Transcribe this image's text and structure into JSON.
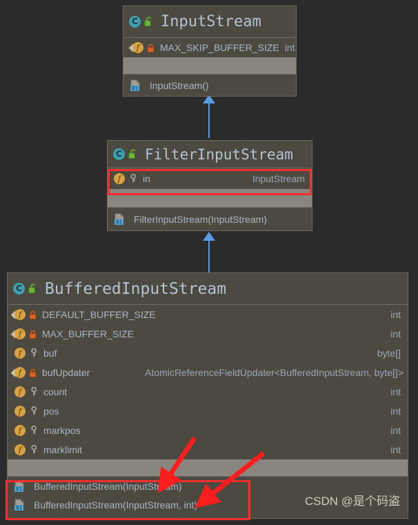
{
  "canvas": {
    "background": "#2b2b2b",
    "box_fill": "#4c4940",
    "box_border": "#6e6b62",
    "divider_band": "#88867f",
    "text_primary": "#a9b7c6",
    "title_color": "#b4c3d4",
    "connector_color": "#5a9ae0",
    "highlight_color": "#f5302c"
  },
  "classes": [
    {
      "id": "input-stream",
      "title": "InputStream",
      "class_icon": "class-icon",
      "visibility_icon": "unlock-icon",
      "fields": [
        {
          "name": "MAX_SKIP_BUFFER_SIZE",
          "type": "int",
          "kind_icon": "static-field-icon",
          "access_icon": "lock-icon",
          "layout": "inline"
        }
      ],
      "methods": [
        {
          "name": "InputStream()",
          "kind_icon": "constructor-icon"
        }
      ]
    },
    {
      "id": "filter-input-stream",
      "title": "FilterInputStream",
      "class_icon": "class-icon",
      "visibility_icon": "unlock-icon",
      "fields": [
        {
          "name": "in",
          "type": "InputStream",
          "kind_icon": "field-icon",
          "access_icon": "key-icon",
          "layout": "spread",
          "highlighted": true
        }
      ],
      "methods": [
        {
          "name": "FilterInputStream(InputStream)",
          "kind_icon": "constructor-icon"
        }
      ]
    },
    {
      "id": "buffered-input-stream",
      "title": "BufferedInputStream",
      "class_icon": "class-icon",
      "visibility_icon": "unlock-icon",
      "fields": [
        {
          "name": "DEFAULT_BUFFER_SIZE",
          "type": "int",
          "kind_icon": "static-field-icon",
          "access_icon": "lock-icon",
          "layout": "spread"
        },
        {
          "name": "MAX_BUFFER_SIZE",
          "type": "int",
          "kind_icon": "static-field-icon",
          "access_icon": "lock-icon",
          "layout": "spread"
        },
        {
          "name": "buf",
          "type": "byte[]",
          "kind_icon": "field-icon",
          "access_icon": "key-icon",
          "layout": "spread"
        },
        {
          "name": "bufUpdater",
          "type": "AtomicReferenceFieldUpdater<BufferedInputStream, byte[]>",
          "kind_icon": "static-field-icon",
          "access_icon": "lock-icon",
          "layout": "spread"
        },
        {
          "name": "count",
          "type": "int",
          "kind_icon": "field-icon",
          "access_icon": "key-icon",
          "layout": "spread"
        },
        {
          "name": "pos",
          "type": "int",
          "kind_icon": "field-icon",
          "access_icon": "key-icon",
          "layout": "spread"
        },
        {
          "name": "markpos",
          "type": "int",
          "kind_icon": "field-icon",
          "access_icon": "key-icon",
          "layout": "spread"
        },
        {
          "name": "marklimit",
          "type": "int",
          "kind_icon": "field-icon",
          "access_icon": "key-icon",
          "layout": "spread"
        }
      ],
      "methods": [
        {
          "name": "BufferedInputStream(InputStream)",
          "kind_icon": "constructor-icon",
          "highlighted": true
        },
        {
          "name": "BufferedInputStream(InputStream, int)",
          "kind_icon": "constructor-icon",
          "highlighted": true
        }
      ]
    }
  ],
  "connectors": [
    {
      "id": "filter-to-input",
      "label": "inheritance-arrow"
    },
    {
      "id": "buffered-to-filter",
      "label": "inheritance-arrow"
    }
  ],
  "annotations": {
    "arrows": [
      {
        "id": "annotation-arrow-1",
        "points_to": "BufferedInputStream(InputStream)"
      },
      {
        "id": "annotation-arrow-2",
        "points_to": "BufferedInputStream(InputStream, int)"
      }
    ]
  },
  "watermark": {
    "text": "CSDN @是个码盗"
  }
}
